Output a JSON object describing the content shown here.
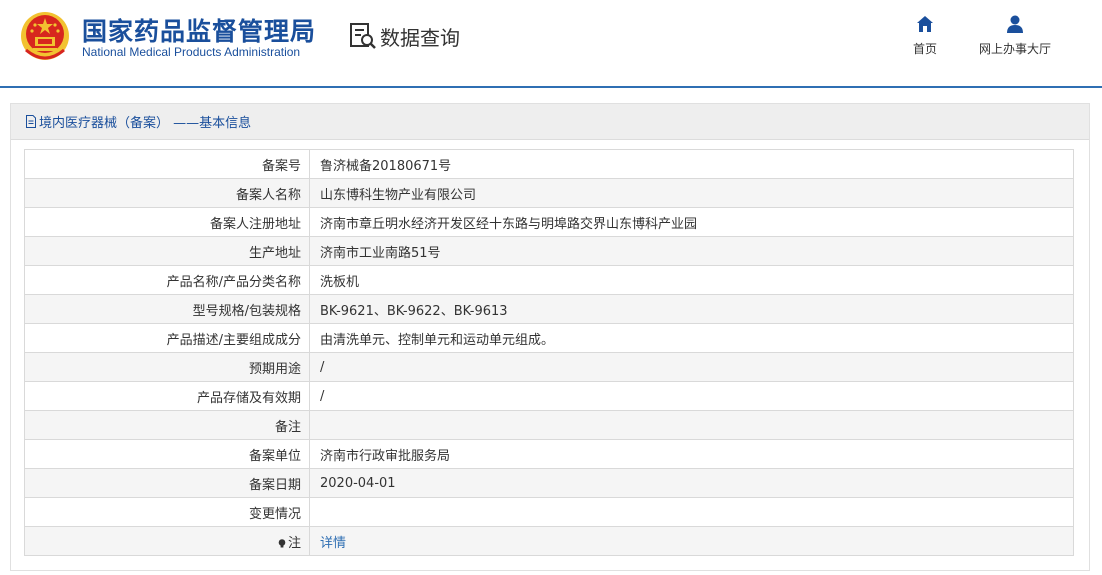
{
  "header": {
    "org_name_cn": "国家药品监督管理局",
    "org_name_en": "National Medical Products Administration",
    "query_label": "数据查询",
    "nav": {
      "home_label": "首页",
      "hall_label": "网上办事大厅"
    }
  },
  "panel": {
    "title": "境内医疗器械（备案） ——基本信息"
  },
  "record": {
    "rows": [
      {
        "label": "备案号",
        "value": "鲁济械备20180671号"
      },
      {
        "label": "备案人名称",
        "value": "山东博科生物产业有限公司"
      },
      {
        "label": "备案人注册地址",
        "value": "济南市章丘明水经济开发区经十东路与明埠路交界山东博科产业园"
      },
      {
        "label": "生产地址",
        "value": "济南市工业南路51号"
      },
      {
        "label": "产品名称/产品分类名称",
        "value": "洗板机"
      },
      {
        "label": "型号规格/包装规格",
        "value": "BK-9621、BK-9622、BK-9613"
      },
      {
        "label": "产品描述/主要组成成分",
        "value": "由清洗单元、控制单元和运动单元组成。"
      },
      {
        "label": "预期用途",
        "value": "/"
      },
      {
        "label": "产品存储及有效期",
        "value": "/"
      },
      {
        "label": "备注",
        "value": ""
      },
      {
        "label": "备案单位",
        "value": "济南市行政审批服务局"
      },
      {
        "label": "备案日期",
        "value": "2020-04-01"
      },
      {
        "label": "变更情况",
        "value": ""
      }
    ],
    "note_label": "注",
    "detail_link": "详情"
  },
  "colors": {
    "brand_blue": "#1a4f9c",
    "link_blue": "#2f6fb3",
    "emblem_red": "#d7261e",
    "emblem_gold": "#f2c230"
  },
  "icons": {
    "emblem": "national-emblem-icon",
    "query": "data-query-icon",
    "home": "home-icon",
    "user": "user-icon",
    "doc": "document-icon",
    "note": "bulb-icon"
  }
}
